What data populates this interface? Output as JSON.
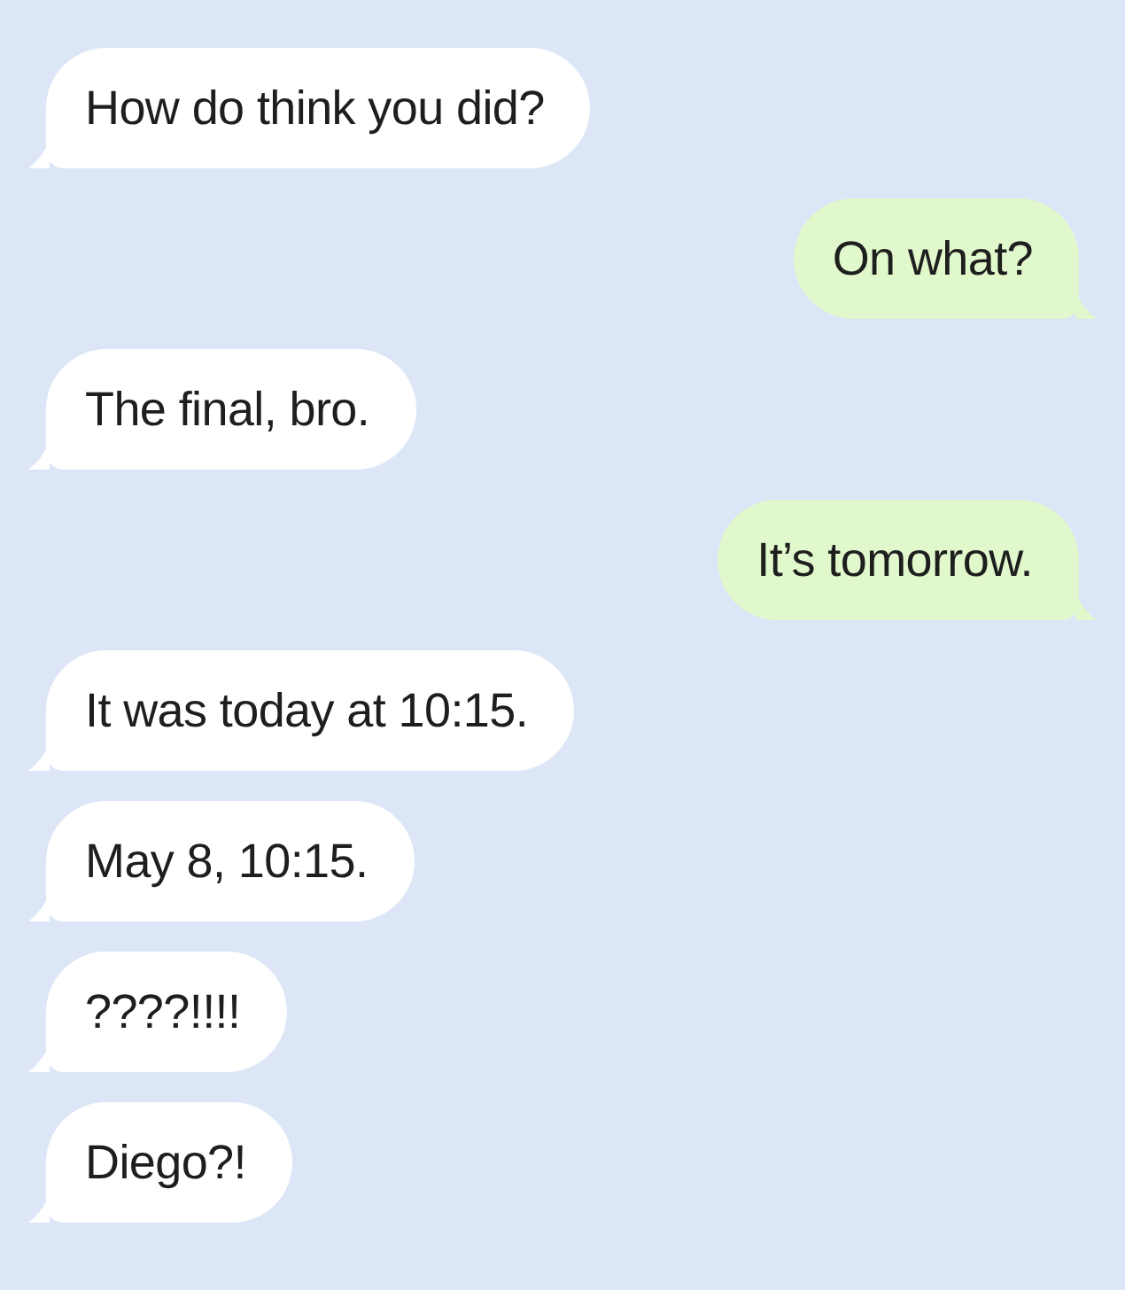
{
  "messages": [
    {
      "kind": "incoming",
      "text": "How do think you did?"
    },
    {
      "kind": "outgoing",
      "text": "On what?"
    },
    {
      "kind": "incoming",
      "text": "The final, bro."
    },
    {
      "kind": "outgoing",
      "text": "It’s tomorrow."
    },
    {
      "kind": "incoming",
      "text": "It was today at 10:15."
    },
    {
      "kind": "incoming",
      "text": "May 8, 10:15."
    },
    {
      "kind": "incoming",
      "text": "????!!!!"
    },
    {
      "kind": "incoming",
      "text": "Diego?!"
    }
  ]
}
